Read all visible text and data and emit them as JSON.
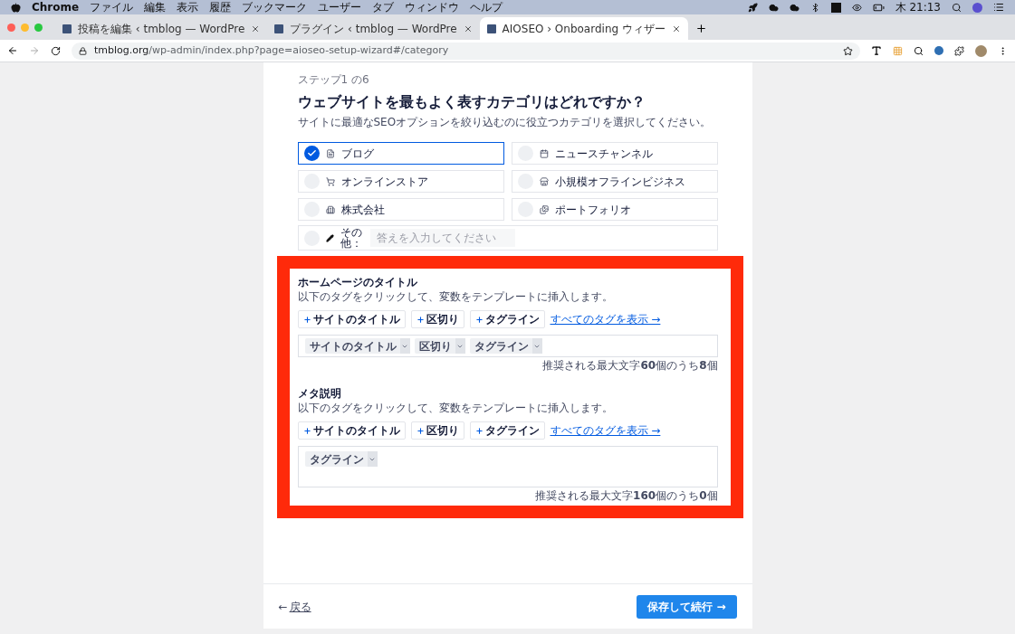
{
  "menubar": {
    "app": "Chrome",
    "items": [
      "ファイル",
      "編集",
      "表示",
      "履歴",
      "ブックマーク",
      "ユーザー",
      "タブ",
      "ウィンドウ",
      "ヘルプ"
    ],
    "clock": "木 21:13"
  },
  "browser": {
    "tabs": [
      {
        "title": "投稿を編集 ‹ tmblog — WordPre",
        "selected": false
      },
      {
        "title": "プラグイン ‹ tmblog — WordPre",
        "selected": false
      },
      {
        "title": "AIOSEO › Onboarding ウィザー",
        "selected": true
      }
    ],
    "url_host": "tmblog.org",
    "url_path": "/wp-admin/index.php?page=aioseo-setup-wizard#/category"
  },
  "wizard": {
    "step": "ステップ1 の6",
    "title": "ウェブサイトを最もよく表すカテゴリはどれですか？",
    "subtitle": "サイトに最適なSEOオプションを絞り込むのに役立つカテゴリを選択してください。",
    "categories": [
      {
        "kind": "blog",
        "label": "ブログ",
        "selected": true
      },
      {
        "kind": "news",
        "label": "ニュースチャンネル",
        "selected": false
      },
      {
        "kind": "store",
        "label": "オンラインストア",
        "selected": false
      },
      {
        "kind": "local",
        "label": "小規模オフラインビジネス",
        "selected": false
      },
      {
        "kind": "corporate",
        "label": "株式会社",
        "selected": false
      },
      {
        "kind": "portfolio",
        "label": "ポートフォリオ",
        "selected": false
      }
    ],
    "other": {
      "label": "その他：",
      "placeholder": "答えを入力してください",
      "selected": false
    },
    "sections": [
      {
        "kind": "single",
        "title": "ホームページのタイトル",
        "help": "以下のタグをクリックして、変数をテンプレートに挿入します。",
        "tag_buttons": [
          "サイトのタイトル",
          "区切り",
          "タグライン"
        ],
        "view_all": "すべてのタグを表示 →",
        "chips": [
          "サイトのタイトル",
          "区切り",
          "タグライン"
        ],
        "counter": "推奨される最大文字**60**個のうち**8**個"
      },
      {
        "kind": "multi",
        "title": "メタ説明",
        "help": "以下のタグをクリックして、変数をテンプレートに挿入します。",
        "tag_buttons": [
          "サイトのタイトル",
          "区切り",
          "タグライン"
        ],
        "view_all": "すべてのタグを表示 →",
        "chips": [
          "タグライン"
        ],
        "counter": "推奨される最大文字**160**個のうち**0**個"
      }
    ],
    "back_arrow": "←",
    "back": "戻る",
    "next": "保存して続行 →"
  }
}
